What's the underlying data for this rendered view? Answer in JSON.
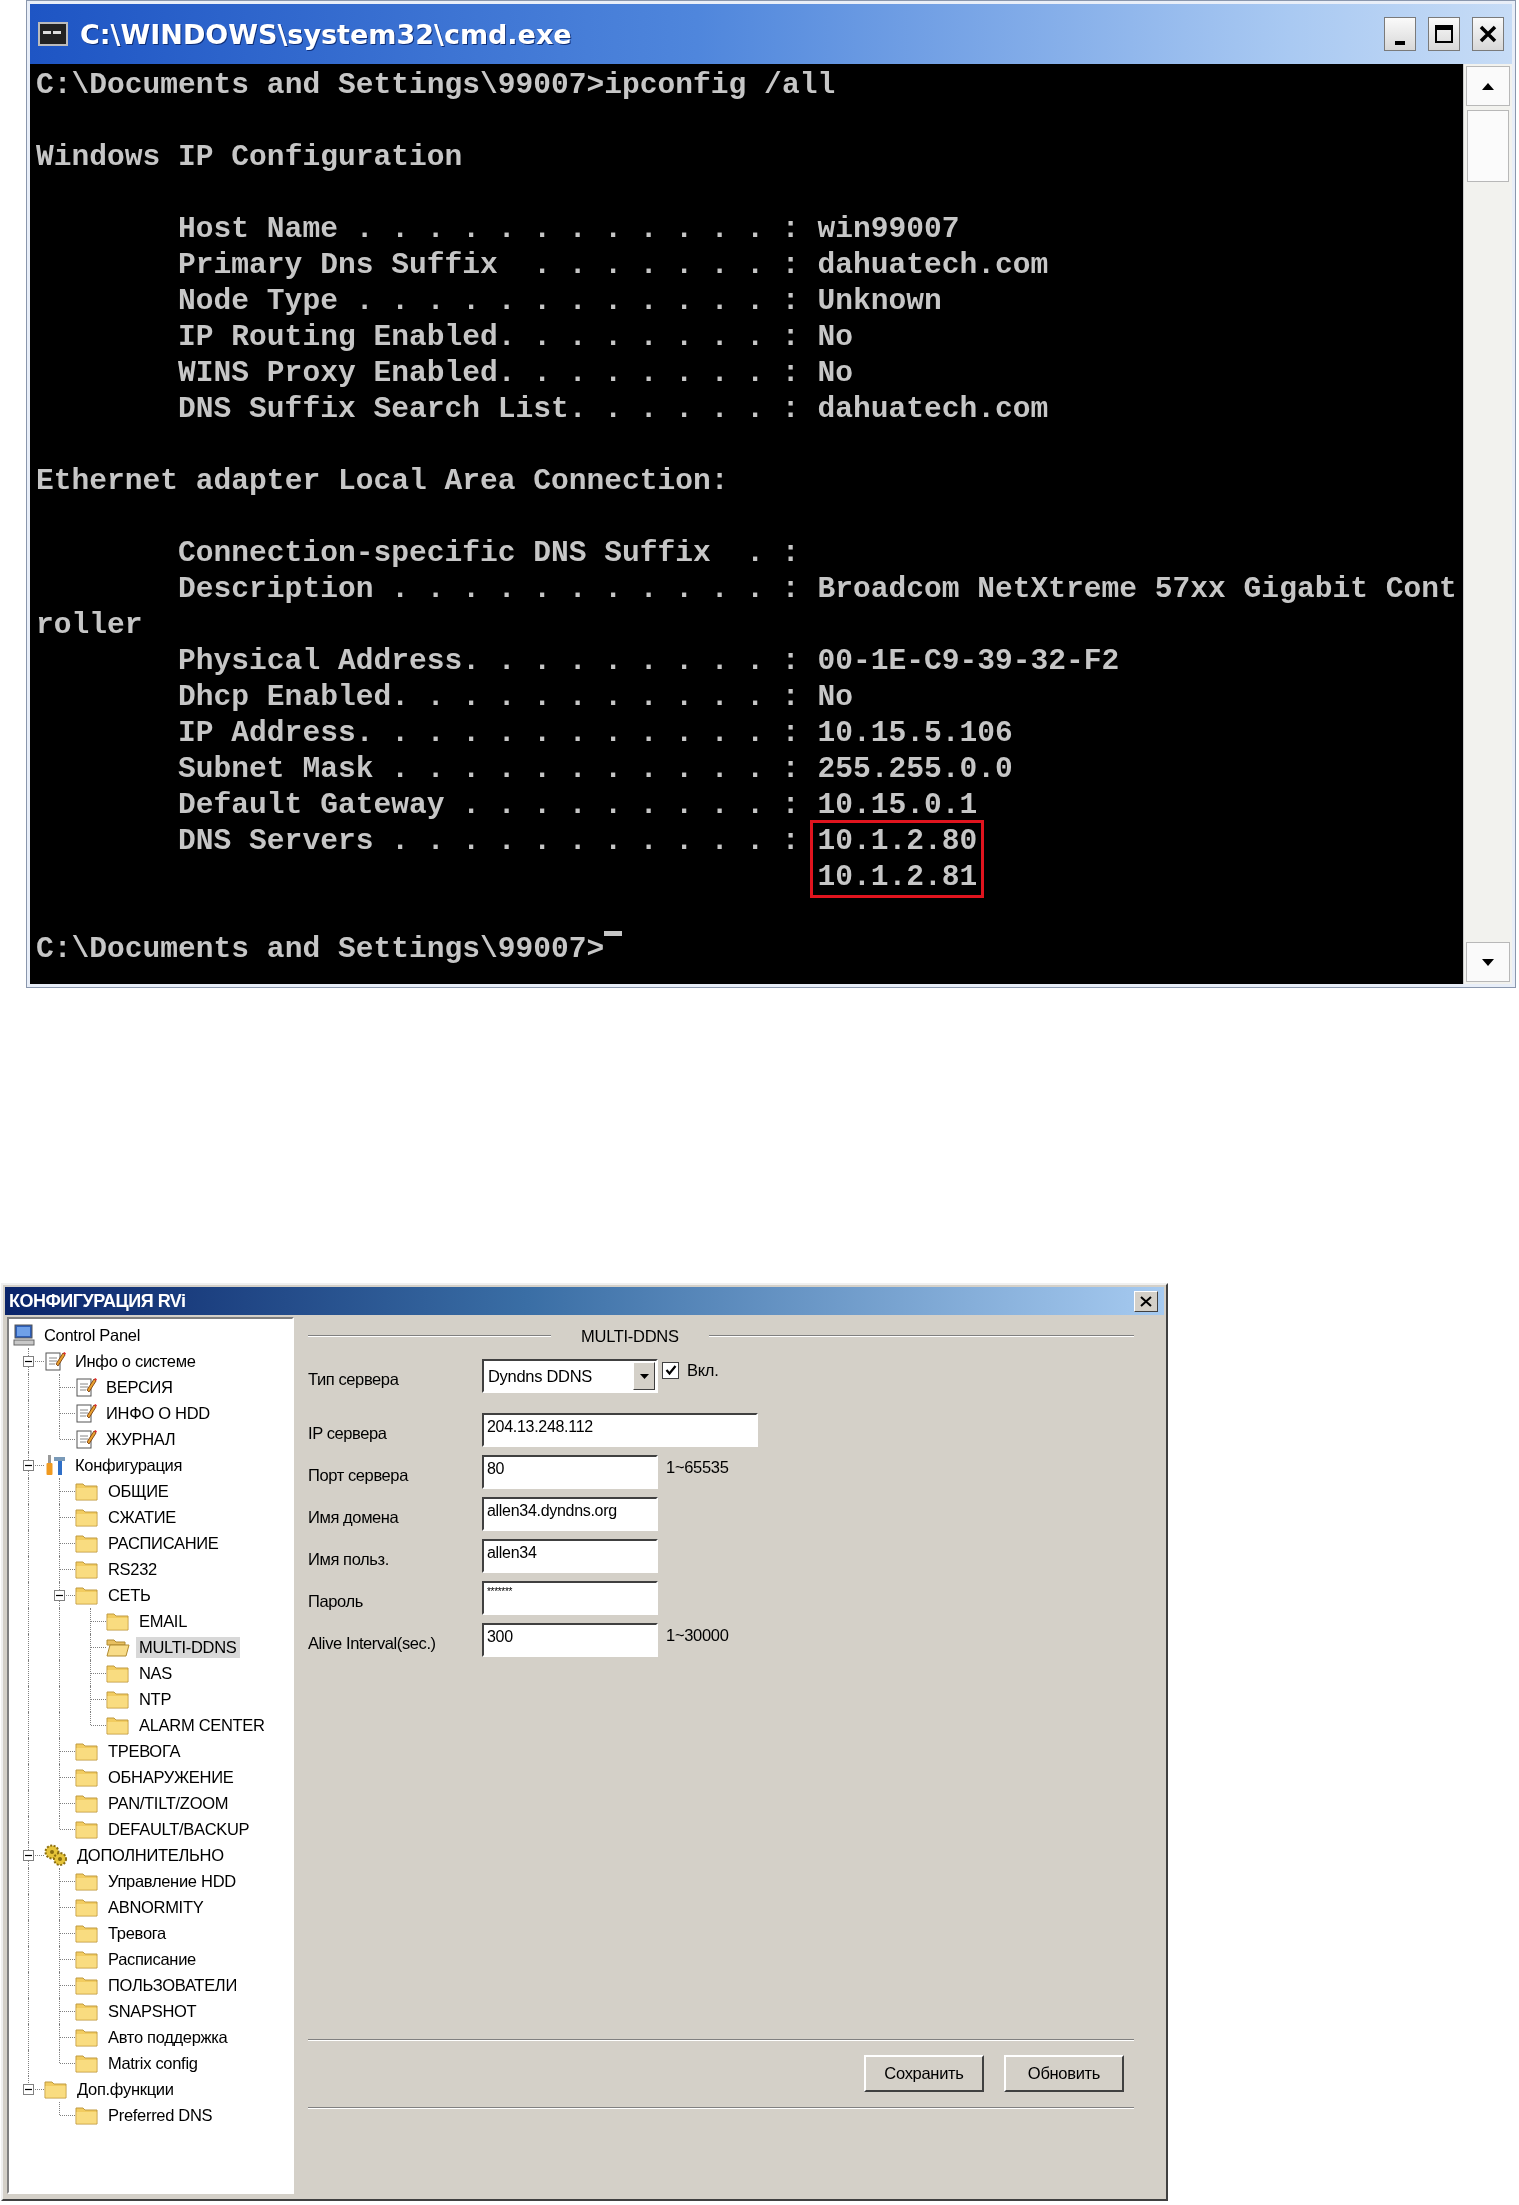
{
  "console_window": {
    "title": "C:\\WINDOWS\\system32\\cmd.exe",
    "lines": [
      {
        "kind": "text",
        "text": "C:\\Documents and Settings\\99007>ipconfig /all"
      },
      {
        "kind": "blank"
      },
      {
        "kind": "text",
        "text": "Windows IP Configuration"
      },
      {
        "kind": "blank"
      },
      {
        "kind": "entry",
        "label": "Host Name . . . . . . . . . . . . :",
        "value": "win99007",
        "highlighted": false
      },
      {
        "kind": "entry",
        "label": "Primary Dns Suffix  . . . . . . . :",
        "value": "dahuatech.com",
        "highlighted": false
      },
      {
        "kind": "entry",
        "label": "Node Type . . . . . . . . . . . . :",
        "value": "Unknown",
        "highlighted": false
      },
      {
        "kind": "entry",
        "label": "IP Routing Enabled. . . . . . . . :",
        "value": "No",
        "highlighted": false
      },
      {
        "kind": "entry",
        "label": "WINS Proxy Enabled. . . . . . . . :",
        "value": "No",
        "highlighted": false
      },
      {
        "kind": "entry",
        "label": "DNS Suffix Search List. . . . . . :",
        "value": "dahuatech.com",
        "highlighted": false
      },
      {
        "kind": "blank"
      },
      {
        "kind": "text",
        "text": "Ethernet adapter Local Area Connection:"
      },
      {
        "kind": "blank"
      },
      {
        "kind": "entry",
        "label": "Connection-specific DNS Suffix  . :"
      },
      {
        "kind": "entry",
        "label": "Description . . . . . . . . . . . :",
        "value": "Broadcom NetXtreme 57xx Gigabit Cont",
        "highlighted": false
      },
      {
        "kind": "text",
        "text": "roller"
      },
      {
        "kind": "entry",
        "label": "Physical Address. . . . . . . . . :",
        "value": "00-1E-C9-39-32-F2",
        "highlighted": false
      },
      {
        "kind": "entry",
        "label": "Dhcp Enabled. . . . . . . . . . . :",
        "value": "No",
        "highlighted": false
      },
      {
        "kind": "entry",
        "label": "IP Address. . . . . . . . . . . . :",
        "value": "10.15.5.106",
        "highlighted": false
      },
      {
        "kind": "entry",
        "label": "Subnet Mask . . . . . . . . . . . :",
        "value": "255.255.0.0",
        "highlighted": false
      },
      {
        "kind": "entry",
        "label": "Default Gateway . . . . . . . . . :",
        "value": "10.15.0.1",
        "highlighted": false
      },
      {
        "kind": "entry",
        "label": "DNS Servers . . . . . . . . . . . :",
        "values": [
          "10.1.2.80",
          "10.1.2.81"
        ],
        "highlighted": true
      },
      {
        "kind": "blank"
      },
      {
        "kind": "prompt",
        "text": "C:\\Documents and Settings\\99007>"
      }
    ]
  },
  "config_window": {
    "title": "КОНФИГУРАЦИЯ RVi",
    "tree": [
      {
        "label": "Control Panel",
        "kind": "monitor",
        "selected": false,
        "children": [
          {
            "label": "Инфо о системе",
            "kind": "notepad",
            "expanded": true,
            "selected": false,
            "children": [
              {
                "label": "ВЕРСИЯ",
                "kind": "notepad",
                "selected": false
              },
              {
                "label": "ИНФО О HDD",
                "kind": "notepad",
                "selected": false
              },
              {
                "label": "ЖУРНАЛ",
                "kind": "notepad",
                "selected": false
              }
            ]
          },
          {
            "label": "Конфигурация",
            "kind": "tools",
            "expanded": true,
            "selected": false,
            "children": [
              {
                "label": "ОБЩИЕ",
                "kind": "folder",
                "selected": false
              },
              {
                "label": "СЖАТИЕ",
                "kind": "folder",
                "selected": false
              },
              {
                "label": "РАСПИСАНИЕ",
                "kind": "folder",
                "selected": false
              },
              {
                "label": "RS232",
                "kind": "folder",
                "selected": false
              },
              {
                "label": "СЕТЬ",
                "kind": "folder",
                "expanded": true,
                "selected": false,
                "children": [
                  {
                    "label": "EMAIL",
                    "kind": "folder",
                    "selected": false
                  },
                  {
                    "label": "MULTI-DDNS",
                    "kind": "folder",
                    "selected": true
                  },
                  {
                    "label": "NAS",
                    "kind": "folder",
                    "selected": false
                  },
                  {
                    "label": "NTP",
                    "kind": "folder",
                    "selected": false
                  },
                  {
                    "label": "ALARM CENTER",
                    "kind": "folder",
                    "selected": false
                  }
                ]
              },
              {
                "label": "ТРЕВОГА",
                "kind": "folder",
                "selected": false
              },
              {
                "label": "ОБНАРУЖЕНИЕ",
                "kind": "folder",
                "selected": false
              },
              {
                "label": "PAN/TILT/ZOOM",
                "kind": "folder",
                "selected": false
              },
              {
                "label": "DEFAULT/BACKUP",
                "kind": "folder",
                "selected": false
              }
            ]
          },
          {
            "label": "ДОПОЛНИТЕЛЬНО",
            "kind": "gears",
            "expanded": true,
            "selected": false,
            "children": [
              {
                "label": "Управление HDD",
                "kind": "folder",
                "selected": false
              },
              {
                "label": "ABNORMITY",
                "kind": "folder",
                "selected": false
              },
              {
                "label": "Тревога",
                "kind": "folder",
                "selected": false
              },
              {
                "label": "Расписание",
                "kind": "folder",
                "selected": false
              },
              {
                "label": "ПОЛЬЗОВАТЕЛИ",
                "kind": "folder",
                "selected": false
              },
              {
                "label": "SNAPSHOT",
                "kind": "folder",
                "selected": false
              },
              {
                "label": "Авто поддержка",
                "kind": "folder",
                "selected": false
              },
              {
                "label": "Matrix config",
                "kind": "folder",
                "selected": false
              }
            ]
          },
          {
            "label": "Доп.функции",
            "kind": "folder",
            "expanded": true,
            "selected": false,
            "children": [
              {
                "label": "Preferred DNS",
                "kind": "folder",
                "selected": false
              }
            ]
          }
        ]
      }
    ],
    "section_title": "MULTI-DDNS",
    "fields": [
      {
        "kind": "select",
        "label": "Тип сервера",
        "value": "Dyndns DDNS",
        "checkbox": {
          "label": "Вкл.",
          "checked": true
        }
      },
      {
        "kind": "wide",
        "label": "IP сервера",
        "value": "204.13.248.112"
      },
      {
        "kind": "text",
        "label": "Порт сервера",
        "value": "80",
        "hint": "1~65535"
      },
      {
        "kind": "text",
        "label": "Имя домена",
        "value": "allen34.dyndns.org"
      },
      {
        "kind": "text",
        "label": "Имя польз.",
        "value": "allen34"
      },
      {
        "kind": "password",
        "label": "Пароль",
        "value": "*******"
      },
      {
        "kind": "text",
        "label": "Alive Interval(sec.)",
        "value": "300",
        "hint": "1~30000"
      }
    ],
    "buttons": [
      "Сохранить",
      "Обновить"
    ]
  }
}
